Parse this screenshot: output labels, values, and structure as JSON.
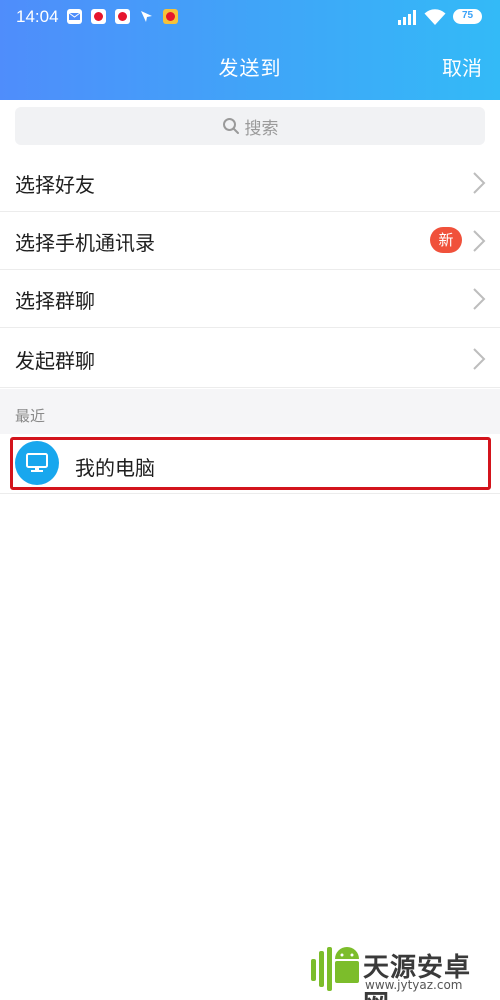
{
  "status_bar": {
    "time": "14:04",
    "battery": "75",
    "notification_icons": [
      "mail-icon",
      "weibo-icon",
      "weibo-icon",
      "navigation-icon",
      "weibo-icon"
    ]
  },
  "header": {
    "title": "发送到",
    "cancel_label": "取消"
  },
  "search": {
    "placeholder": "搜索"
  },
  "menu": {
    "items": [
      {
        "label": "选择好友"
      },
      {
        "label": "选择手机通讯录",
        "badge": "新"
      },
      {
        "label": "选择群聊"
      },
      {
        "label": "发起群聊"
      }
    ]
  },
  "recent": {
    "section_label": "最近",
    "items": [
      {
        "label": "我的电脑",
        "icon": "computer-icon"
      }
    ]
  },
  "watermark": {
    "name": "天源安卓网",
    "url": "www.jytyaz.com"
  },
  "colors": {
    "header_start": "#4f8dfb",
    "header_end": "#33baf7",
    "badge": "#f0513b",
    "avatar": "#18a7ee",
    "highlight": "#d3141c"
  }
}
